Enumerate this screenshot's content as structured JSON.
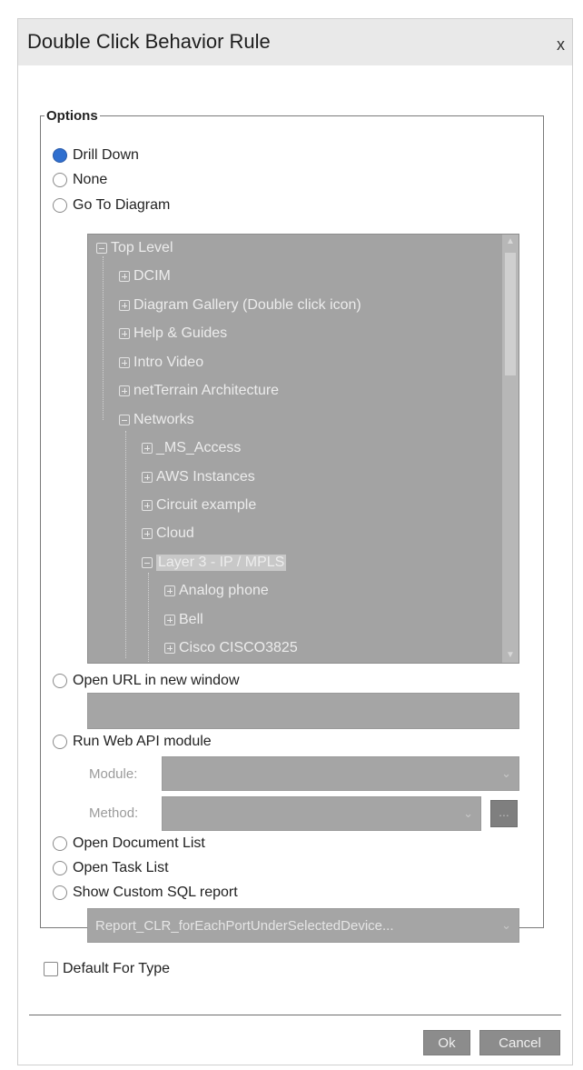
{
  "dialog": {
    "title": "Double Click Behavior Rule",
    "close_label": "x"
  },
  "options": {
    "legend": "Options",
    "drill_down": "Drill Down",
    "none": "None",
    "go_to_diagram": "Go To Diagram",
    "open_url": "Open URL in new window",
    "run_web_api": "Run Web API module",
    "open_document_list": "Open Document List",
    "open_task_list": "Open Task List",
    "show_custom_sql": "Show Custom SQL report",
    "selected": "Drill Down"
  },
  "tree": {
    "items": [
      {
        "label": "Top Level",
        "expanded": true
      },
      {
        "label": "DCIM",
        "expanded": false
      },
      {
        "label": "Diagram Gallery (Double click icon)",
        "expanded": false
      },
      {
        "label": "Help & Guides",
        "expanded": false
      },
      {
        "label": "Intro Video",
        "expanded": false
      },
      {
        "label": "netTerrain Architecture",
        "expanded": false
      },
      {
        "label": "Networks",
        "expanded": true
      },
      {
        "label": "_MS_Access",
        "expanded": false
      },
      {
        "label": "AWS Instances",
        "expanded": false
      },
      {
        "label": "Circuit example",
        "expanded": false
      },
      {
        "label": "Cloud",
        "expanded": false
      },
      {
        "label": "Layer 3 - IP / MPLS",
        "expanded": true,
        "selected": true
      },
      {
        "label": "Analog phone",
        "expanded": false
      },
      {
        "label": "Bell",
        "expanded": false
      },
      {
        "label": "Cisco CISCO3825",
        "expanded": false
      }
    ]
  },
  "url_input": {
    "value": ""
  },
  "web_api": {
    "module_label": "Module:",
    "method_label": "Method:",
    "module_value": "",
    "method_value": "",
    "method_button_label": "..."
  },
  "sql_report": {
    "value": "Report_CLR_forEachPortUnderSelectedDevice..."
  },
  "default_for_type": "Default For Type",
  "buttons": {
    "ok": "Ok",
    "cancel": "Cancel"
  },
  "colors": {
    "radio_selected": "#2f6fcf",
    "disabled_bg": "#a3a3a3",
    "button_bg": "#8c8c8c"
  }
}
